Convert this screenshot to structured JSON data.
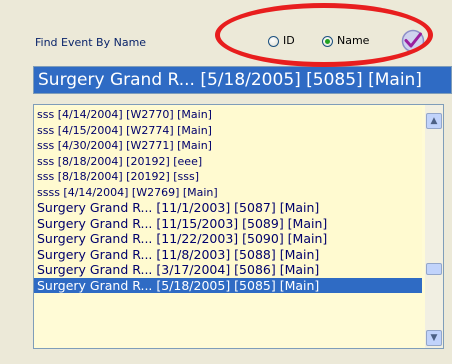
{
  "find_label": "Find Event By Name",
  "radio_options": [
    {
      "label": "ID",
      "checked": false
    },
    {
      "label": "Name",
      "checked": true
    }
  ],
  "icons": {
    "confirm": "checkmark-icon",
    "scroll_up": "arrow-up-icon",
    "scroll_down": "arrow-down-icon"
  },
  "colors": {
    "selection": "#2f6bc4",
    "list_background": "#fffad0",
    "annotation": "#e81e1e",
    "radio_checked": "#21a121"
  },
  "search_value": "Surgery Grand R... [5/18/2005] [5085] [Main]",
  "events": [
    {
      "text": "sss [4/14/2004] [W2770] [Main]",
      "small": true
    },
    {
      "text": "sss [4/15/2004] [W2774] [Main]",
      "small": true
    },
    {
      "text": "sss [4/30/2004] [W2771] [Main]",
      "small": true
    },
    {
      "text": "sss [8/18/2004] [20192] [eee]",
      "small": true
    },
    {
      "text": "sss [8/18/2004] [20192] [sss]",
      "small": true
    },
    {
      "text": "ssss [4/14/2004] [W2769] [Main]",
      "small": true
    },
    {
      "text": "Surgery Grand R... [11/1/2003] [5087] [Main]",
      "small": false
    },
    {
      "text": "Surgery Grand R... [11/15/2003] [5089] [Main]",
      "small": false
    },
    {
      "text": "Surgery Grand R... [11/22/2003] [5090] [Main]",
      "small": false
    },
    {
      "text": "Surgery Grand R... [11/8/2003] [5088] [Main]",
      "small": false
    },
    {
      "text": "Surgery Grand R... [3/17/2004] [5086] [Main]",
      "small": false
    },
    {
      "text": "Surgery Grand R... [5/18/2005] [5085] [Main]",
      "small": false,
      "selected": true
    }
  ]
}
